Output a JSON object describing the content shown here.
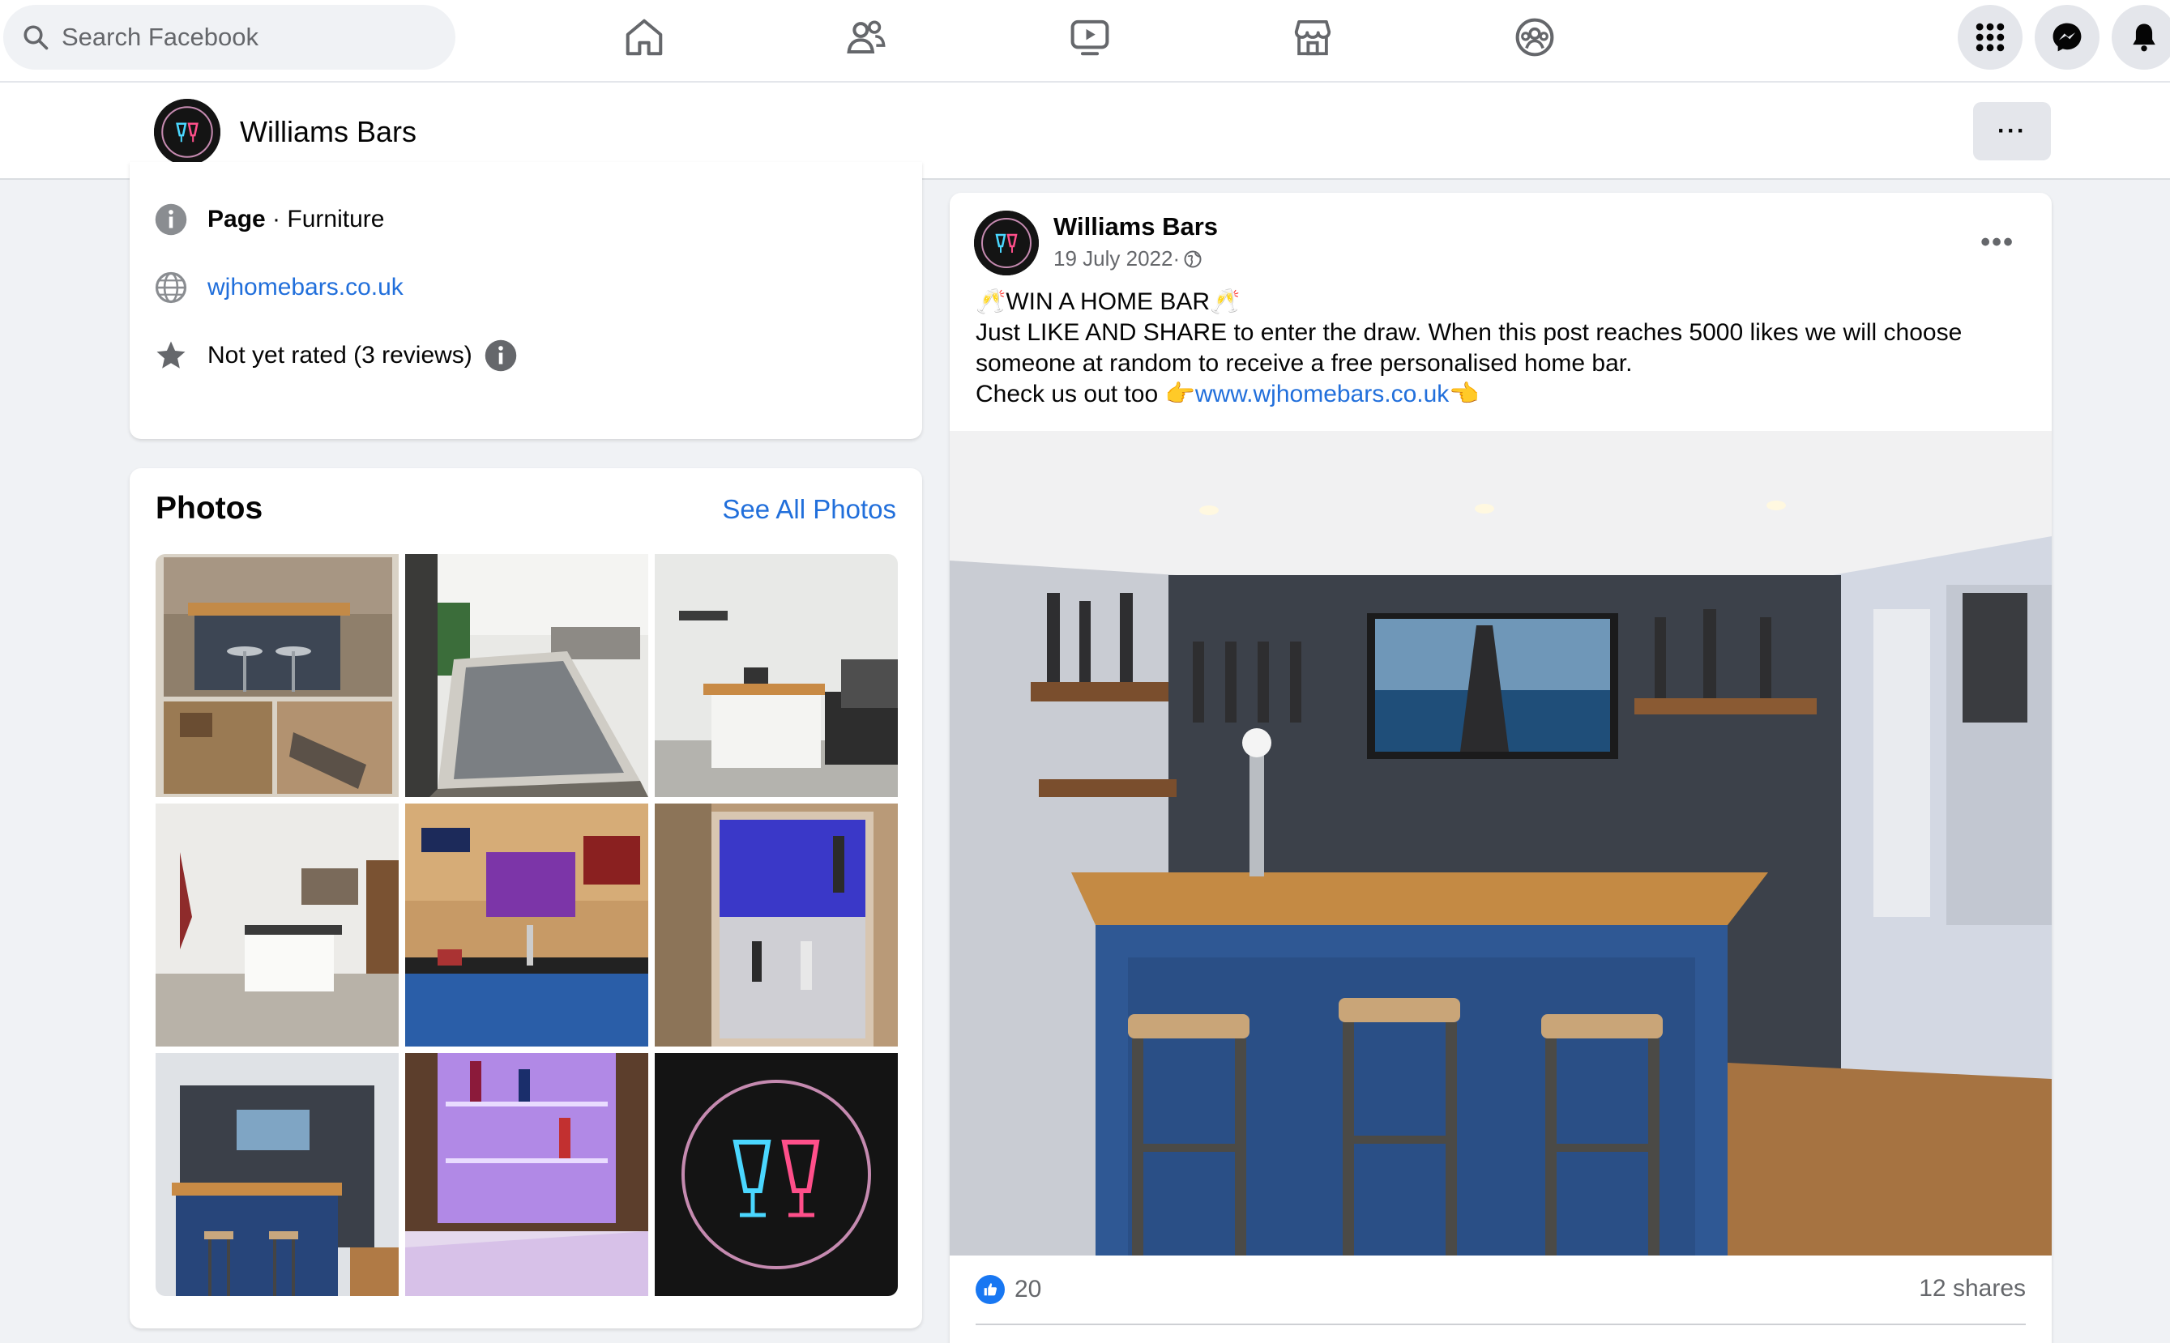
{
  "topbar": {
    "search_placeholder": "Search Facebook",
    "nav_icons": [
      "home-icon",
      "friends-icon",
      "watch-icon",
      "marketplace-icon",
      "groups-icon"
    ],
    "right_icons": [
      "menu-grid-icon",
      "messenger-icon",
      "notifications-icon"
    ]
  },
  "page": {
    "name": "Williams Bars",
    "more_label": "···"
  },
  "intro": {
    "category_label": "Page",
    "category_value": " · Furniture",
    "website": "wjhomebars.co.uk",
    "rating": "Not yet rated (3 reviews)"
  },
  "photos": {
    "title": "Photos",
    "see_all": "See All Photos"
  },
  "post": {
    "author": "Williams Bars",
    "date": "19 July 2022·",
    "text_line1": "🥂WIN A HOME BAR🥂",
    "text_line2": "Just LIKE AND SHARE to enter the draw. When this post reaches 5000 likes we will choose",
    "text_line3": "someone at random to receive a free personalised home bar.",
    "text_line4_prefix": "Check us out too 👉",
    "text_link": "www.wjhomebars.co.uk",
    "text_line4_suffix": "👈",
    "likes": "20",
    "shares": "12 shares"
  },
  "colors": {
    "accent": "#1877f2",
    "link": "#216fdb",
    "background": "#f0f2f5"
  }
}
